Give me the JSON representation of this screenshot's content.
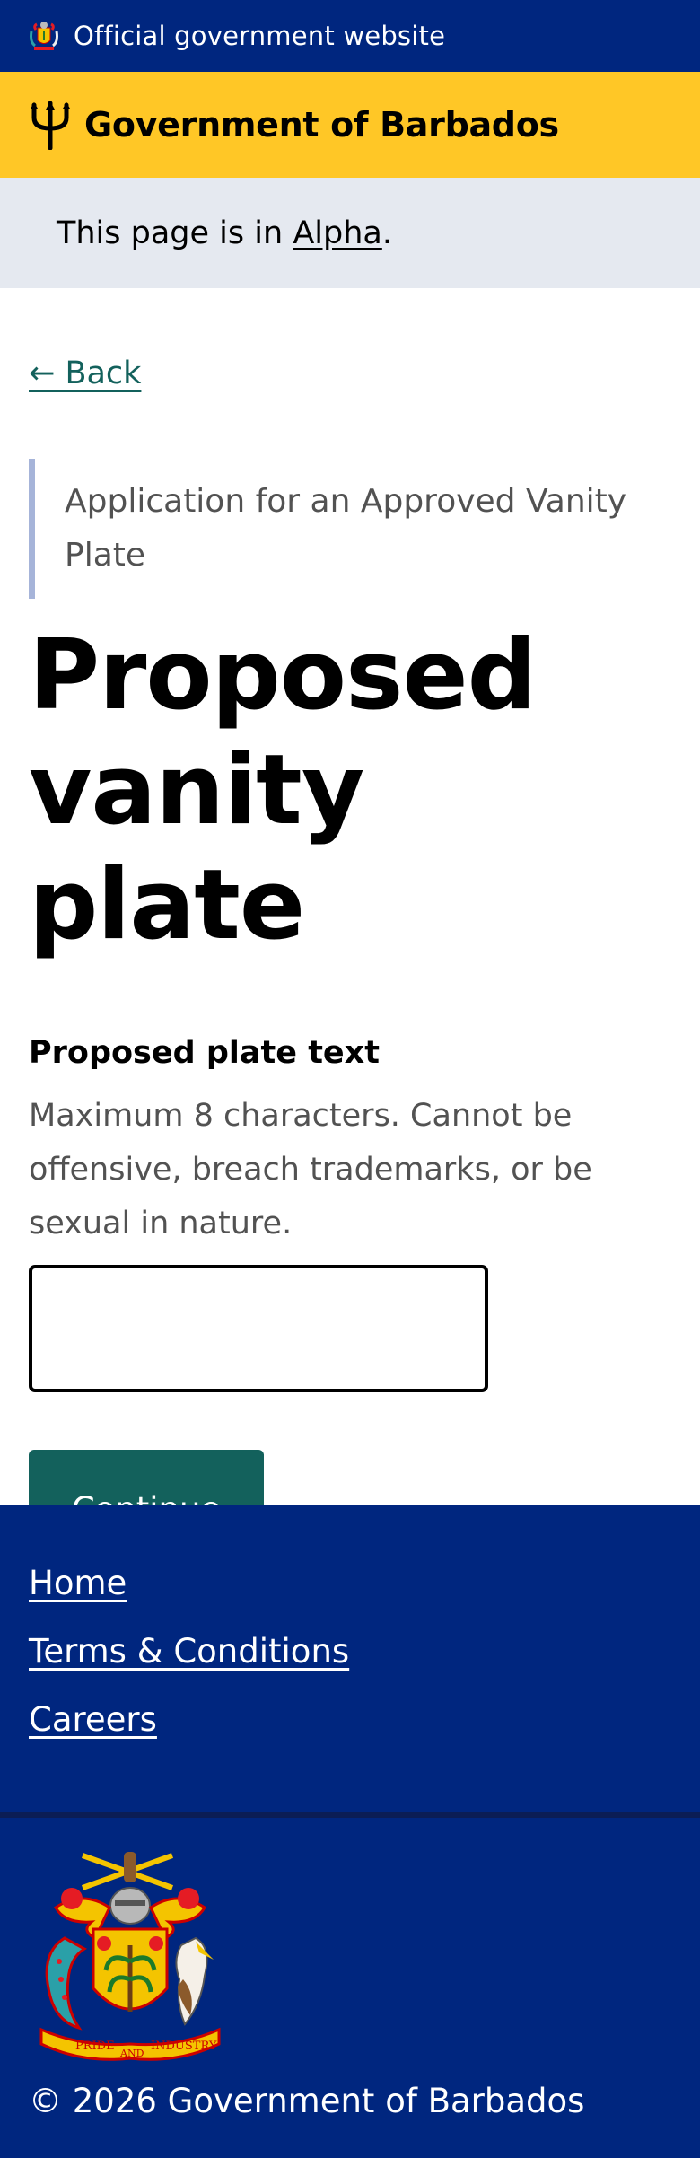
{
  "header": {
    "official_text": "Official government website",
    "brand_name": "Government of Barbados",
    "icons": [
      "coat-of-arms-icon",
      "trident-icon"
    ],
    "colors": {
      "top_bar": "#00267f",
      "brand_bar": "#ffc726"
    }
  },
  "phase_banner": {
    "prefix": "This page is in ",
    "phase_link": "Alpha",
    "suffix": "."
  },
  "back_link": "← Back",
  "form": {
    "caption": "Application for an Approved Vanity Plate",
    "title": "Proposed vanity plate",
    "field_label": "Proposed plate text",
    "field_hint": "Maximum 8 characters. Cannot be offensive, breach trademarks, or be sexual in nature.",
    "field_value": "",
    "continue_label": "Continue",
    "accent_color": "#13615c"
  },
  "footer": {
    "links": [
      "Home",
      "Terms & Conditions",
      "Careers"
    ],
    "motto_words": [
      "PRIDE",
      "AND",
      "INDUSTRY"
    ],
    "copyright": "© 2026 Government of Barbados"
  }
}
